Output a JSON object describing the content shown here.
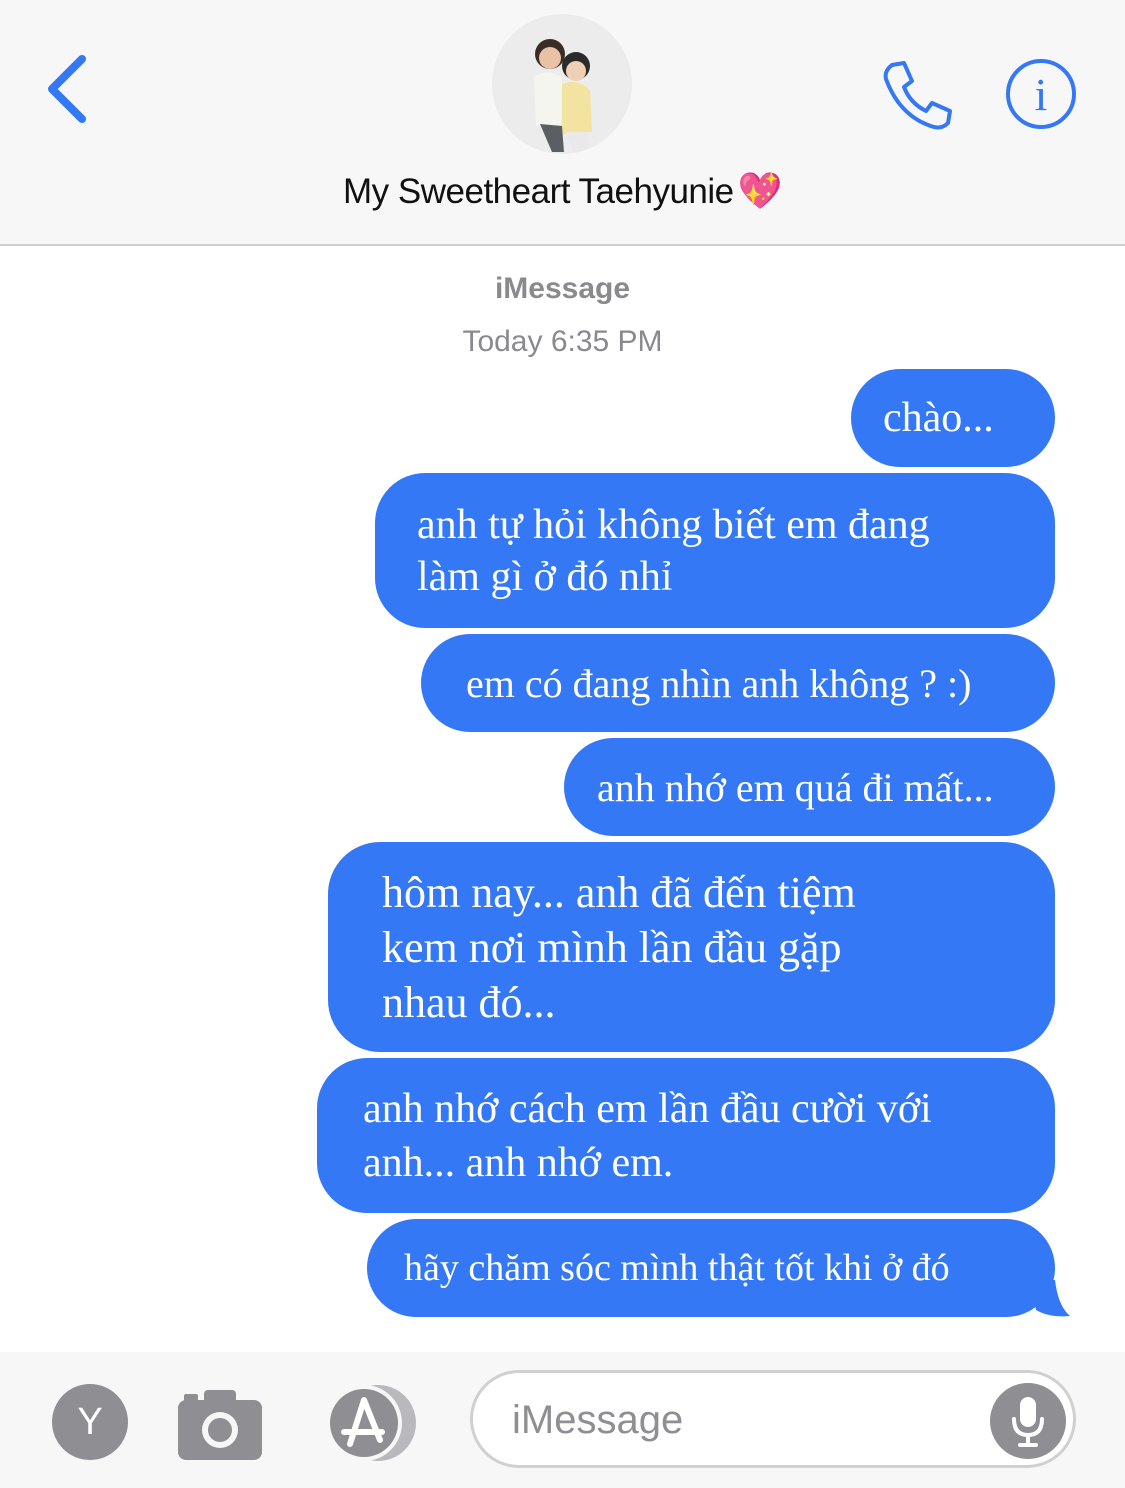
{
  "header": {
    "contact_name": "My Sweetheart Taehyunie",
    "contact_emoji": "💖",
    "icons": [
      "back-chevron-icon",
      "avatar-photo",
      "phone-icon",
      "info-icon"
    ],
    "accent_color": "#3478f6"
  },
  "conversation": {
    "service": "iMessage",
    "timestamp": "Today 6:35 PM",
    "bubble_color": "#3478f6",
    "messages": [
      {
        "lines": [
          "chào..."
        ]
      },
      {
        "lines": [
          "anh tự hỏi không biết em đang",
          "làm gì ở đó nhỉ"
        ]
      },
      {
        "lines": [
          "em có đang nhìn anh không ? :)"
        ]
      },
      {
        "lines": [
          "anh nhớ em quá đi mất..."
        ]
      },
      {
        "lines": [
          "hôm nay... anh đã đến tiệm",
          "kem nơi mình lần đầu gặp",
          "nhau đó..."
        ]
      },
      {
        "lines": [
          "anh nhớ cách em lần đầu cười với",
          "anh... anh nhớ em."
        ]
      },
      {
        "lines": [
          "hãy chăm sóc mình thật tốt khi ở đó"
        ]
      }
    ]
  },
  "composer": {
    "apps_label": "Y",
    "placeholder": "iMessage",
    "icons": [
      "camera-icon",
      "app-store-icon",
      "microphone-icon"
    ]
  }
}
